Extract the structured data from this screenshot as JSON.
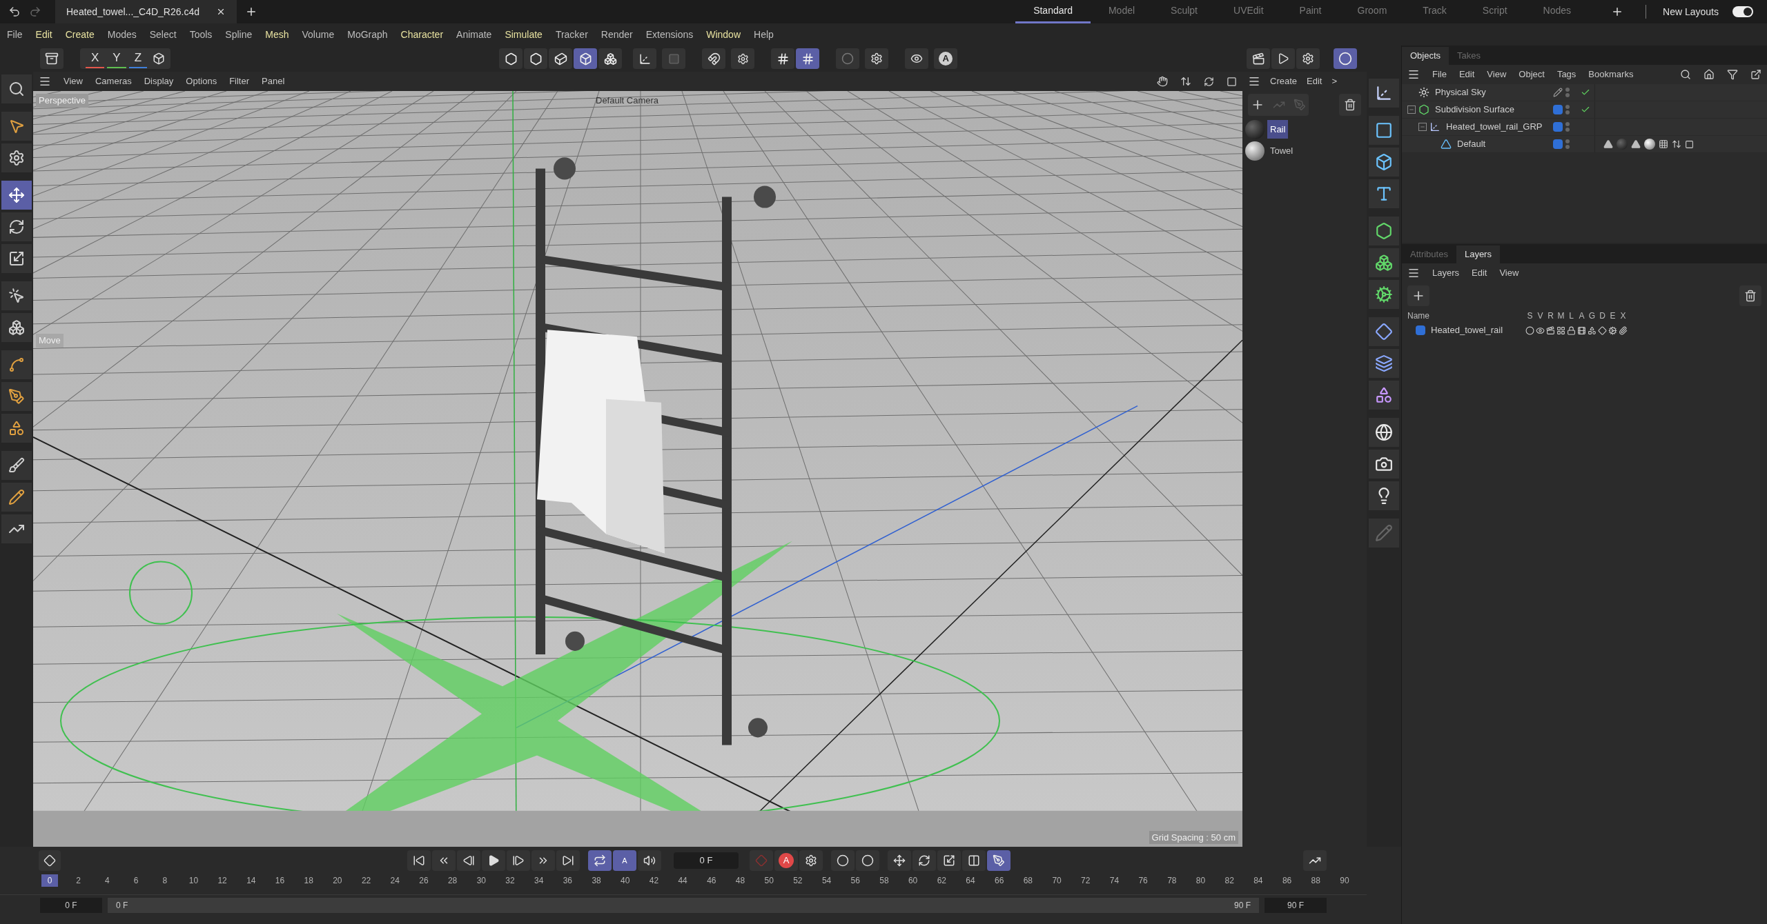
{
  "file_tab": {
    "title": "Heated_towel..._C4D_R26.c4d"
  },
  "layouts": [
    {
      "label": "Standard",
      "selected": true
    },
    {
      "label": "Model",
      "selected": false
    },
    {
      "label": "Sculpt",
      "selected": false
    },
    {
      "label": "UVEdit",
      "selected": false
    },
    {
      "label": "Paint",
      "selected": false
    },
    {
      "label": "Groom",
      "selected": false
    },
    {
      "label": "Track",
      "selected": false
    },
    {
      "label": "Script",
      "selected": false
    },
    {
      "label": "Nodes",
      "selected": false
    }
  ],
  "new_layouts": {
    "label": "New Layouts",
    "on": true
  },
  "menu": [
    {
      "label": "File",
      "highlighted": false
    },
    {
      "label": "Edit",
      "highlighted": true
    },
    {
      "label": "Create",
      "highlighted": true
    },
    {
      "label": "Modes",
      "highlighted": false
    },
    {
      "label": "Select",
      "highlighted": false
    },
    {
      "label": "Tools",
      "highlighted": false
    },
    {
      "label": "Spline",
      "highlighted": false
    },
    {
      "label": "Mesh",
      "highlighted": true
    },
    {
      "label": "Volume",
      "highlighted": false
    },
    {
      "label": "MoGraph",
      "highlighted": false
    },
    {
      "label": "Character",
      "highlighted": true
    },
    {
      "label": "Animate",
      "highlighted": false
    },
    {
      "label": "Simulate",
      "highlighted": true
    },
    {
      "label": "Tracker",
      "highlighted": false
    },
    {
      "label": "Render",
      "highlighted": false
    },
    {
      "label": "Extensions",
      "highlighted": false
    },
    {
      "label": "Window",
      "highlighted": true
    },
    {
      "label": "Help",
      "highlighted": false
    }
  ],
  "toolbar": {
    "axes": [
      {
        "label": "X",
        "color": "#e2574c"
      },
      {
        "label": "Y",
        "color": "#5fbf4f"
      },
      {
        "label": "Z",
        "color": "#3f7fd9"
      }
    ],
    "modes": [
      {
        "selected": false
      },
      {
        "selected": false
      },
      {
        "selected": false
      },
      {
        "selected": true
      },
      {
        "selected": false
      }
    ],
    "snapping": [
      {
        "selected": false
      },
      {
        "selected": true
      }
    ],
    "view_letter": "A"
  },
  "tools": [
    {
      "selected": false
    },
    {
      "selected": false
    },
    {
      "selected": false
    },
    {
      "selected": true
    },
    {
      "selected": false
    },
    {
      "selected": false
    },
    {
      "selected": false
    },
    {
      "selected": false
    },
    {
      "selected": false
    },
    {
      "selected": false
    },
    {
      "selected": false
    },
    {
      "selected": false
    },
    {
      "selected": false
    },
    {
      "selected": false
    }
  ],
  "viewport": {
    "menu": [
      "View",
      "Cameras",
      "Display",
      "Options",
      "Filter",
      "Panel"
    ],
    "camera": "Perspective",
    "title": "Default Camera",
    "tool_hint": "Move",
    "grid_spacing": "Grid Spacing : 50 cm"
  },
  "materials": {
    "menu": [
      "Create",
      "Edit",
      ">"
    ],
    "items": [
      {
        "name": "Rail",
        "selected": true
      },
      {
        "name": "Towel",
        "selected": false
      }
    ]
  },
  "objects": {
    "tabs": [
      {
        "label": "Objects",
        "selected": true
      },
      {
        "label": "Takes",
        "selected": false
      }
    ],
    "menu": [
      "File",
      "Edit",
      "View",
      "Object",
      "Tags",
      "Bookmarks"
    ],
    "tree": [
      {
        "name": "Physical Sky",
        "kind": "sky",
        "enabled": true
      },
      {
        "name": "Subdivision Surface",
        "kind": "subdivision",
        "color": "#2f6fd6",
        "enabled": true,
        "expanded": true,
        "children": [
          {
            "name": "Heated_towel_rail_GRP",
            "kind": "group",
            "color": "#2f6fd6",
            "expanded": true,
            "children": [
              {
                "name": "Default",
                "kind": "polygon",
                "color": "#2f6fd6",
                "tags": [
                  {
                    "kind": "triangle"
                  },
                  {
                    "kind": "dark"
                  },
                  {
                    "kind": "triangle"
                  },
                  {
                    "kind": "light"
                  },
                  {
                    "kind": "checker"
                  },
                  {
                    "kind": "arrows"
                  },
                  {
                    "kind": "phong"
                  }
                ]
              }
            ]
          }
        ]
      }
    ]
  },
  "layers": {
    "tabs": [
      {
        "label": "Attributes",
        "selected": false
      },
      {
        "label": "Layers",
        "selected": true
      }
    ],
    "menu": [
      "Layers",
      "Edit",
      "View"
    ],
    "columns": [
      "Name",
      "S",
      "V",
      "R",
      "M",
      "L",
      "A",
      "G",
      "D",
      "E",
      "X"
    ],
    "rows": [
      {
        "name": "Heated_towel_rail",
        "color": "#2f6fd6"
      }
    ]
  },
  "timeline": {
    "frame": "0 F",
    "autokey": "A",
    "autokey_dots": "A",
    "start": "0 F",
    "range_start": "0 F",
    "range_end": "90 F",
    "end": "90 F",
    "range": {
      "level": 1
    },
    "ruler": [
      {
        "label": "0",
        "selected": true
      },
      {
        "label": "2",
        "selected": false
      },
      {
        "label": "4",
        "selected": false
      },
      {
        "label": "6",
        "selected": false
      },
      {
        "label": "8",
        "selected": false
      },
      {
        "label": "10",
        "selected": false
      },
      {
        "label": "12",
        "selected": false
      },
      {
        "label": "14",
        "selected": false
      },
      {
        "label": "16",
        "selected": false
      },
      {
        "label": "18",
        "selected": false
      },
      {
        "label": "20",
        "selected": false
      },
      {
        "label": "22",
        "selected": false
      },
      {
        "label": "24",
        "selected": false
      },
      {
        "label": "26",
        "selected": false
      },
      {
        "label": "28",
        "selected": false
      },
      {
        "label": "30",
        "selected": false
      },
      {
        "label": "32",
        "selected": false
      },
      {
        "label": "34",
        "selected": false
      },
      {
        "label": "36",
        "selected": false
      },
      {
        "label": "38",
        "selected": false
      },
      {
        "label": "40",
        "selected": false
      },
      {
        "label": "42",
        "selected": false
      },
      {
        "label": "44",
        "selected": false
      },
      {
        "label": "46",
        "selected": false
      },
      {
        "label": "48",
        "selected": false
      },
      {
        "label": "50",
        "selected": false
      },
      {
        "label": "52",
        "selected": false
      },
      {
        "label": "54",
        "selected": false
      },
      {
        "label": "56",
        "selected": false
      },
      {
        "label": "58",
        "selected": false
      },
      {
        "label": "60",
        "selected": false
      },
      {
        "label": "62",
        "selected": false
      },
      {
        "label": "64",
        "selected": false
      },
      {
        "label": "66",
        "selected": false
      },
      {
        "label": "68",
        "selected": false
      },
      {
        "label": "70",
        "selected": false
      },
      {
        "label": "72",
        "selected": false
      },
      {
        "label": "74",
        "selected": false
      },
      {
        "label": "76",
        "selected": false
      },
      {
        "label": "78",
        "selected": false
      },
      {
        "label": "80",
        "selected": false
      },
      {
        "label": "82",
        "selected": false
      },
      {
        "label": "84",
        "selected": false
      },
      {
        "label": "86",
        "selected": false
      },
      {
        "label": "88",
        "selected": false
      },
      {
        "label": "90",
        "selected": false
      }
    ],
    "transport": [
      {
        "selected": true
      },
      {
        "selected": true
      },
      {
        "selected": false
      }
    ],
    "keys": [
      {
        "selected": true
      }
    ]
  }
}
